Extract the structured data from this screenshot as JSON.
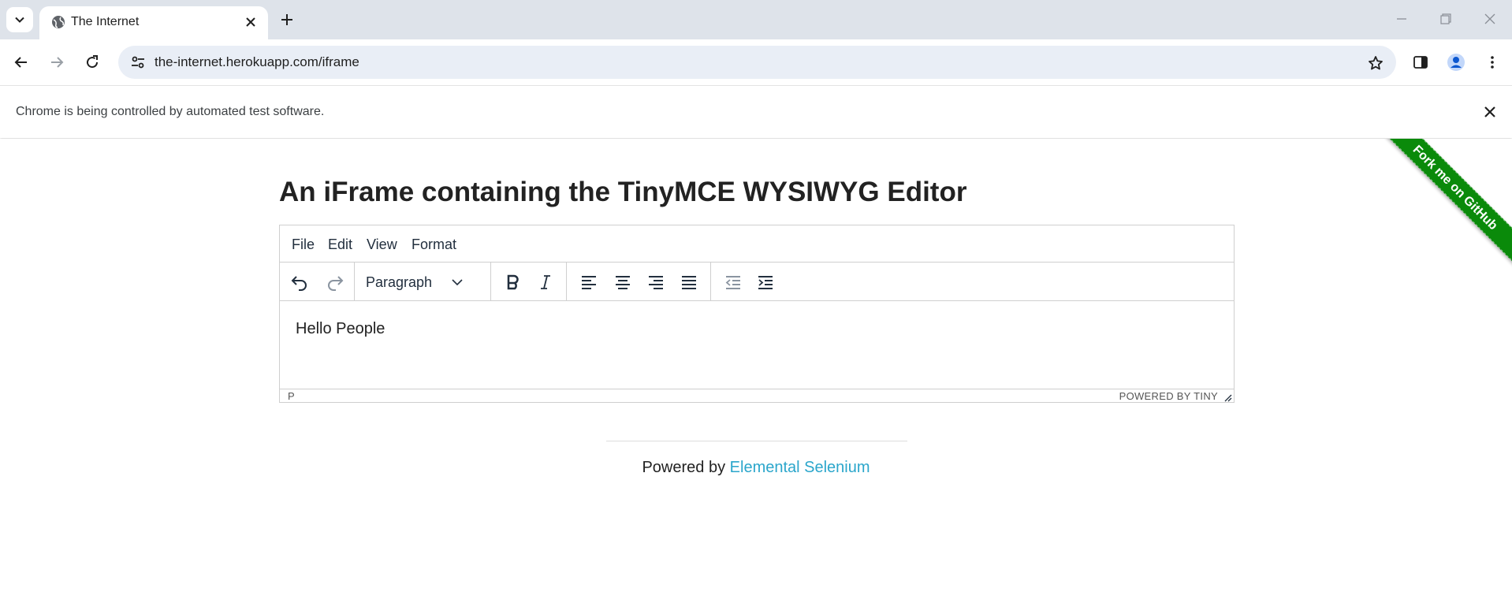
{
  "browser": {
    "tab_title": "The Internet",
    "url": "the-internet.herokuapp.com/iframe",
    "infobar_message": "Chrome is being controlled by automated test software."
  },
  "page": {
    "ribbon_text": "Fork me on GitHub",
    "heading": "An iFrame containing the TinyMCE WYSIWYG Editor"
  },
  "editor": {
    "menu": [
      "File",
      "Edit",
      "View",
      "Format"
    ],
    "block_format": "Paragraph",
    "content": "Hello People",
    "element_path": "P",
    "branding": "POWERED BY TINY"
  },
  "footer": {
    "prefix": "Powered by",
    "link_text": "Elemental Selenium"
  }
}
